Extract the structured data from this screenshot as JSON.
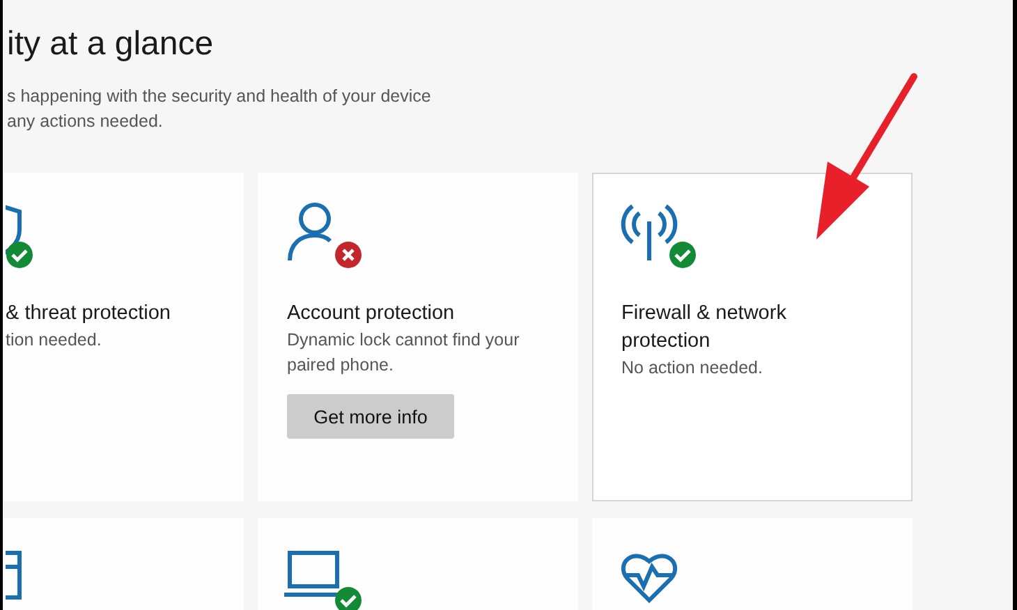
{
  "header": {
    "title": "ity at a glance",
    "subtitle_lines": [
      "s happening with the security and health of your device",
      "any actions needed."
    ]
  },
  "rows": [
    [
      {
        "kind": "shield",
        "badge": {
          "kind": "ok"
        },
        "title": "& threat protection",
        "detail": "tion needed.",
        "selected": false
      },
      {
        "kind": "person",
        "badge": {
          "kind": "error"
        },
        "title": "Account protection",
        "detail": "Dynamic lock cannot find your paired phone.",
        "button": "Get more info",
        "selected": false
      },
      {
        "kind": "antenna",
        "badge": {
          "kind": "ok"
        },
        "title": "Firewall & network protection",
        "detail": "No action needed.",
        "selected": true
      }
    ],
    [
      {
        "kind": "app",
        "selected": false
      },
      {
        "kind": "laptop",
        "badge": {
          "kind": "ok"
        },
        "selected": false
      },
      {
        "kind": "heart",
        "selected": false
      }
    ]
  ],
  "annotation": {
    "kind": "arrow"
  }
}
